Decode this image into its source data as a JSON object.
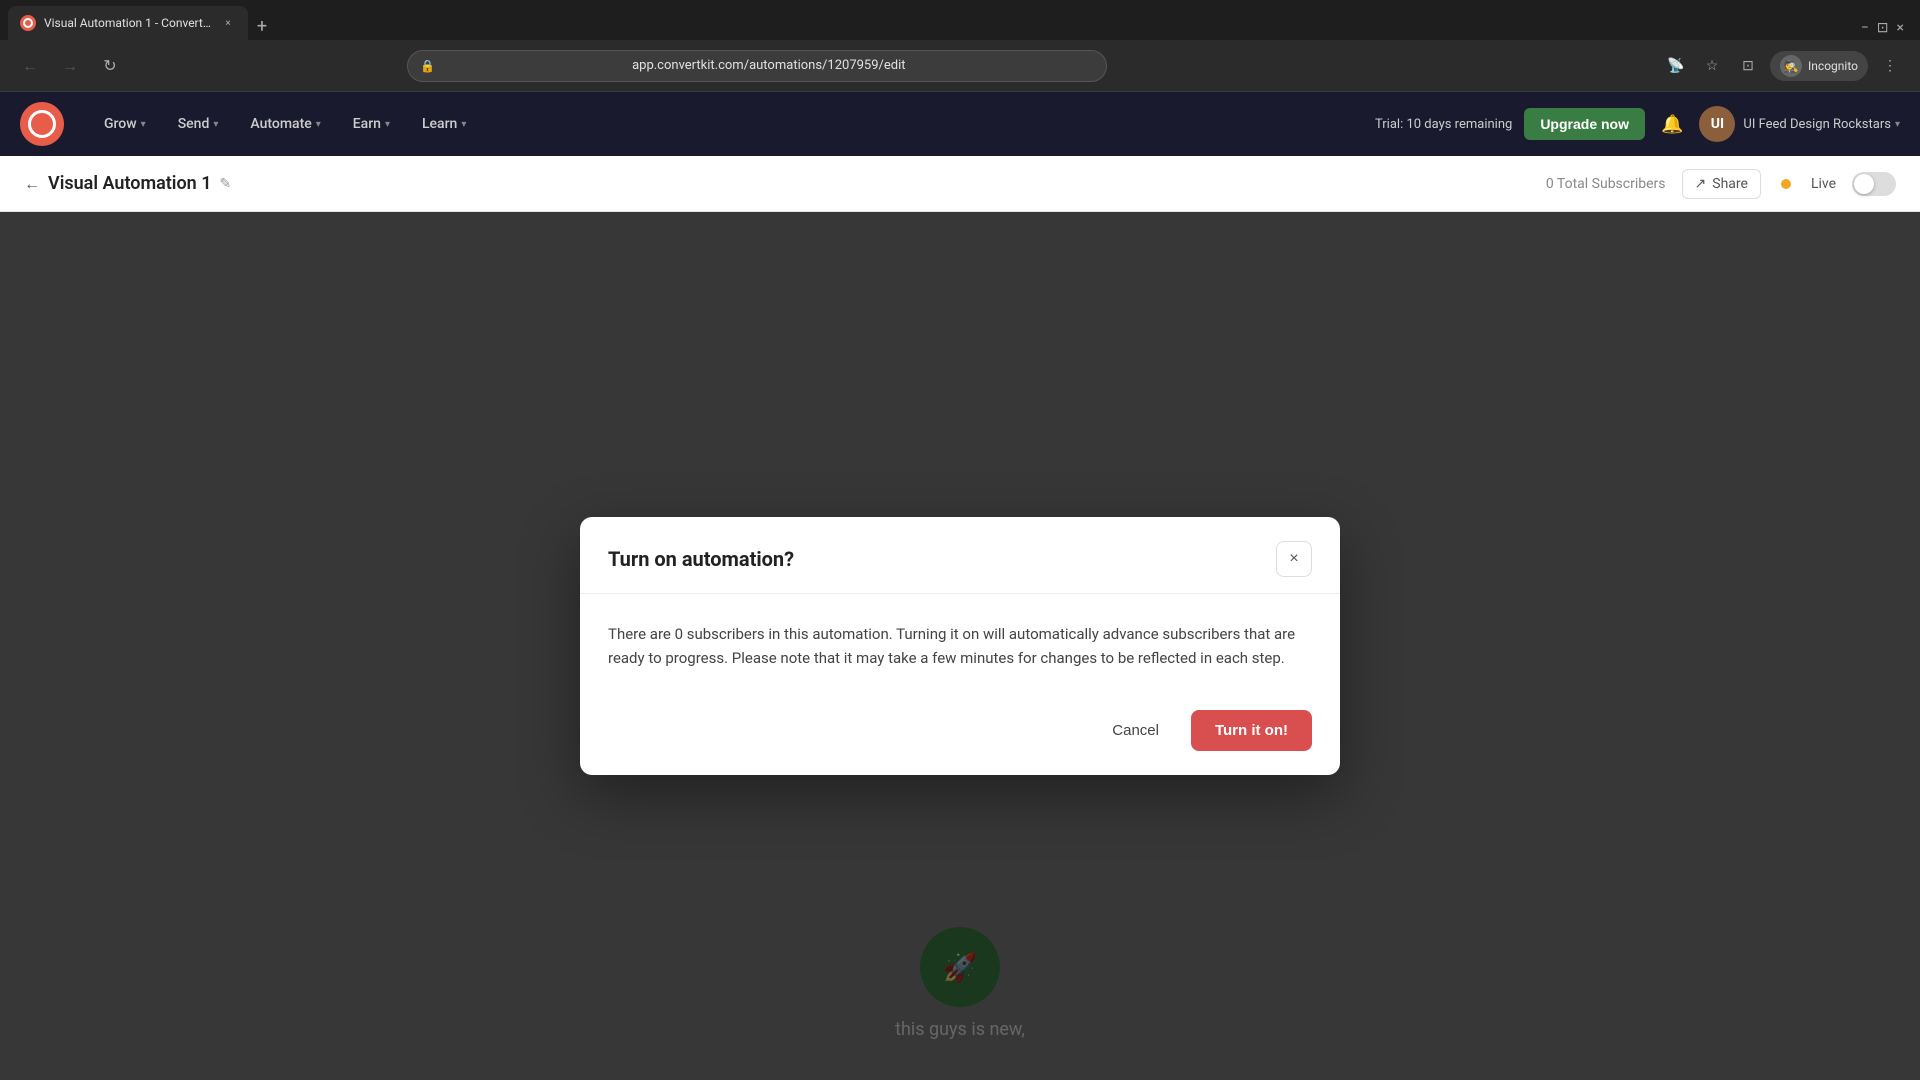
{
  "browser": {
    "tab_title": "Visual Automation 1 - ConvertKit",
    "tab_favicon": "●",
    "address_url": "app.convertkit.com/automations/1207959/edit",
    "new_tab_label": "+",
    "nav": {
      "back": "←",
      "forward": "→",
      "refresh": "↻"
    },
    "incognito_label": "Incognito",
    "window_controls": {
      "minimize": "−",
      "maximize": "⊡",
      "close": "×"
    }
  },
  "topnav": {
    "grow_label": "Grow",
    "send_label": "Send",
    "automate_label": "Automate",
    "earn_label": "Earn",
    "learn_label": "Learn",
    "trial_text": "Trial: 10 days remaining",
    "upgrade_label": "Upgrade now",
    "user_name": "UI Feed Design Rockstars"
  },
  "subheader": {
    "back_arrow": "←",
    "page_title": "Visual Automation 1",
    "edit_icon": "✎",
    "subscribers_text": "0 Total Subscribers",
    "share_label": "Share",
    "live_label": "Live"
  },
  "modal": {
    "title": "Turn on automation?",
    "description": "There are 0 subscribers in this automation. Turning it on will automatically advance subscribers that are ready to progress. Please note that it may take a few minutes for changes to be reflected in each step.",
    "cancel_label": "Cancel",
    "confirm_label": "Turn it on!",
    "close_icon": "×"
  },
  "canvas": {
    "node_label": "this guys is new,",
    "node_icon": "🚀"
  },
  "colors": {
    "brand_red": "#e85d4a",
    "upgrade_green": "#3a7d44",
    "confirm_red": "#d94f4f",
    "nav_bg": "#1a1a2e"
  }
}
